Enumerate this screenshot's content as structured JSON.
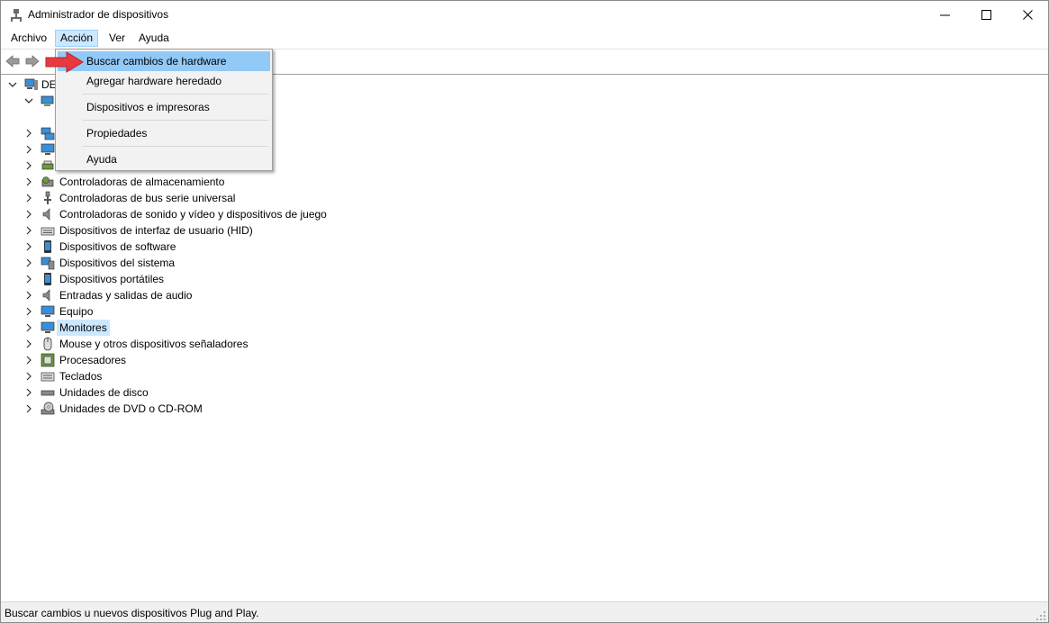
{
  "window": {
    "title": "Administrador de dispositivos"
  },
  "menubar": {
    "items": [
      "Archivo",
      "Acción",
      "Ver",
      "Ayuda"
    ],
    "active_index": 1
  },
  "tree": {
    "root_label": "DE",
    "categories": [
      "Controladoras de almacenamiento",
      "Controladoras de bus serie universal",
      "Controladoras de sonido y vídeo y dispositivos de juego",
      "Dispositivos de interfaz de usuario (HID)",
      "Dispositivos de software",
      "Dispositivos del sistema",
      "Dispositivos portátiles",
      "Entradas y salidas de audio",
      "Equipo",
      "Monitores",
      "Mouse y otros dispositivos señaladores",
      "Procesadores",
      "Teclados",
      "Unidades de disco",
      "Unidades de DVD o CD-ROM"
    ],
    "selected": "Monitores"
  },
  "dropdown": {
    "items": [
      "Buscar cambios de hardware",
      "Agregar hardware heredado",
      "Dispositivos e impresoras",
      "Propiedades",
      "Ayuda"
    ],
    "highlighted_index": 0
  },
  "status": {
    "text": "Buscar cambios u nuevos dispositivos Plug and Play."
  },
  "colors": {
    "highlight": "#91c9f7",
    "selection": "#cce8ff",
    "arrow": "#e8393e"
  }
}
